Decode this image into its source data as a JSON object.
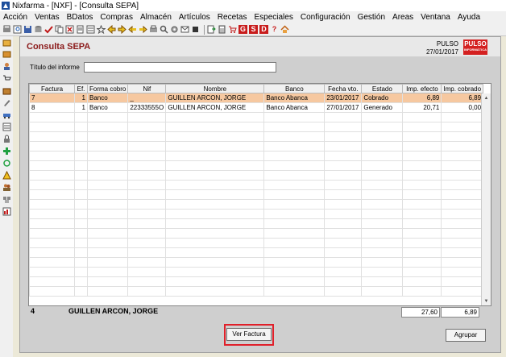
{
  "window": {
    "title": "Nixfarma - [NXF] - [Consulta SEPA]"
  },
  "menu": [
    "Acción",
    "Ventas",
    "BDatos",
    "Compras",
    "Almacén",
    "Artículos",
    "Recetas",
    "Especiales",
    "Configuración",
    "Gestión",
    "Areas",
    "Ventana",
    "Ayuda"
  ],
  "toolbar_letters": {
    "g": "G",
    "s": "S",
    "d": "D",
    "q": "?"
  },
  "panel": {
    "title": "Consulta SEPA",
    "company": "PULSO",
    "date": "27/01/2017",
    "logo": "PULSO",
    "logo_sub": "INFORMÁTICA"
  },
  "form": {
    "report_title_label": "Título del informe",
    "report_title_value": ""
  },
  "table": {
    "columns": [
      "Factura",
      "Ef.",
      "Forma cobro",
      "Nif",
      "Nombre",
      "Banco",
      "Fecha vto.",
      "Estado",
      "Imp. efecto",
      "Imp. cobrado"
    ],
    "rows": [
      [
        "7",
        "1",
        "Banco",
        "_",
        "GUILLEN ARCON, JORGE",
        "Banco Abanca",
        "23/01/2017",
        "Cobrado",
        "6,89",
        "6,89"
      ],
      [
        "8",
        "1",
        "Banco",
        "22333555O",
        "GUILLEN ARCON, JORGE",
        "Banco Abanca",
        "27/01/2017",
        "Generado",
        "20,71",
        "0,00"
      ]
    ]
  },
  "footer": {
    "count": "4",
    "name": "GUILLEN ARCON, JORGE",
    "total_efecto": "27,60",
    "total_cobrado": "6,89"
  },
  "buttons": {
    "ver_factura": "Ver Factura",
    "agrupar": "Agrupar"
  },
  "colors": {
    "title": "#8b1a1a",
    "selected_row": "#f6c8a0",
    "highlight": "#e0202a",
    "logo": "#d42020"
  }
}
